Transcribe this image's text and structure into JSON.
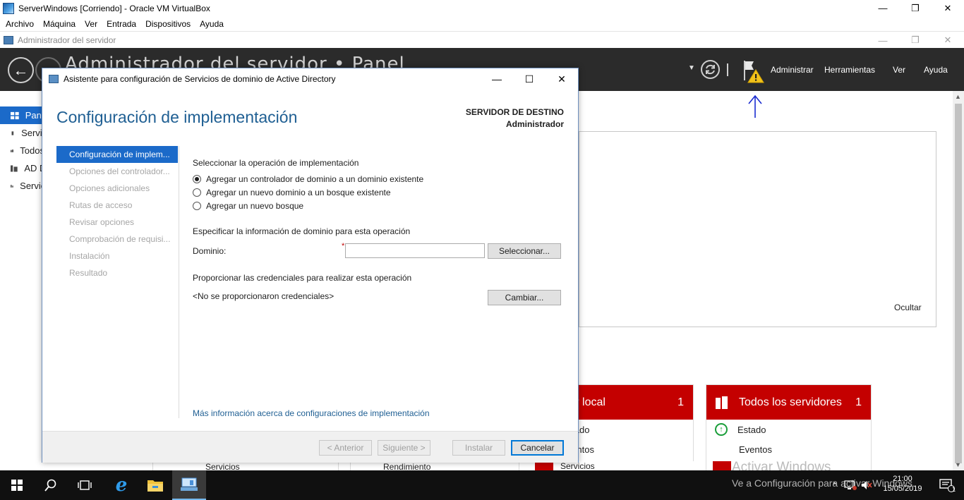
{
  "vbox": {
    "title": "ServerWindows [Corriendo] - Oracle VM VirtualBox",
    "menu": [
      "Archivo",
      "Máquina",
      "Ver",
      "Entrada",
      "Dispositivos",
      "Ayuda"
    ]
  },
  "server_manager": {
    "title": "Administrador del servidor",
    "header_stub": "Administrador del servidor • Panel",
    "menu": {
      "manage": "Administrar",
      "tools": "Herramientas",
      "view": "Ver",
      "help": "Ayuda"
    },
    "sidebar": [
      "Panel",
      "Servidor local",
      "Todos los servidores",
      "AD DS",
      "Servicios de archivos"
    ],
    "hide_link": "Ocultar",
    "tiles": [
      {
        "title": "Servidor local",
        "count": "1",
        "rows": [
          "Estado",
          "Eventos"
        ]
      },
      {
        "title": "Todos los servidores",
        "count": "1",
        "rows": [
          "Estado",
          "Eventos"
        ]
      }
    ],
    "bottom_strip": [
      "Servicios",
      "Rendimiento",
      "Servicios"
    ]
  },
  "wizard": {
    "title": "Asistente para configuración de Servicios de dominio de Active Directory",
    "heading": "Configuración de implementación",
    "target_label": "SERVIDOR DE DESTINO",
    "target_value": "Administrador",
    "steps": [
      "Configuración de implem...",
      "Opciones del controlador...",
      "Opciones adicionales",
      "Rutas de acceso",
      "Revisar opciones",
      "Comprobación de requisi...",
      "Instalación",
      "Resultado"
    ],
    "operation_label": "Seleccionar la operación de implementación",
    "options": [
      "Agregar un controlador de dominio a un dominio existente",
      "Agregar un nuevo dominio a un bosque existente",
      "Agregar un nuevo bosque"
    ],
    "domain_info_label": "Especificar la información de dominio para esta operación",
    "domain_label": "Dominio:",
    "domain_value": "",
    "select_button": "Seleccionar...",
    "credentials_label": "Proporcionar las credenciales para realizar esta operación",
    "credentials_value": "<No se proporcionaron credenciales>",
    "change_button": "Cambiar...",
    "more_info_link": "Más información acerca de configuraciones de implementación",
    "buttons": {
      "back": "< Anterior",
      "next": "Siguiente >",
      "install": "Instalar",
      "cancel": "Cancelar"
    }
  },
  "taskbar": {
    "time": "21:00",
    "date": "15/05/2019",
    "notifications": "1"
  },
  "watermark": {
    "line1": "Activar Windows",
    "line2": "Ve a Configuración para activar Windows."
  },
  "colors": {
    "accent": "#1b6ac9",
    "tile_red": "#c40000",
    "heading_blue": "#1f5f93"
  }
}
